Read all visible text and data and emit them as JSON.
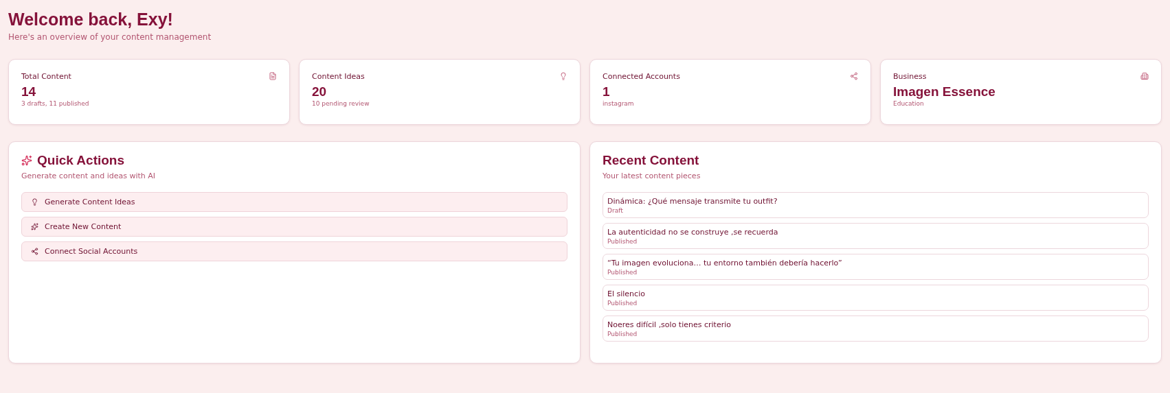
{
  "header": {
    "title": "Welcome back, Exy!",
    "subtitle": "Here's an overview of your content management"
  },
  "stats": [
    {
      "label": "Total Content",
      "value": "14",
      "detail": "3 drafts, 11 published"
    },
    {
      "label": "Content Ideas",
      "value": "20",
      "detail": "10 pending review"
    },
    {
      "label": "Connected Accounts",
      "value": "1",
      "detail": "instagram"
    },
    {
      "label": "Business",
      "value": "Imagen Essence",
      "detail": "Education"
    }
  ],
  "quick_actions": {
    "title": "Quick Actions",
    "subtitle": "Generate content and ideas with AI",
    "actions": [
      {
        "label": "Generate Content Ideas"
      },
      {
        "label": "Create New Content"
      },
      {
        "label": "Connect Social Accounts"
      }
    ]
  },
  "recent_content": {
    "title": "Recent Content",
    "subtitle": "Your latest content pieces",
    "items": [
      {
        "title": "Dinámica: ¿Qué mensaje transmite tu outfit?",
        "status": "Draft"
      },
      {
        "title": "La autenticidad no se construye ,se recuerda",
        "status": "Published"
      },
      {
        "title": "“Tu imagen evoluciona… tu entorno también debería hacerlo”",
        "status": "Published"
      },
      {
        "title": "El silencio",
        "status": "Published"
      },
      {
        "title": "Noeres difícil ,solo tienes criterio",
        "status": "Published"
      }
    ]
  }
}
